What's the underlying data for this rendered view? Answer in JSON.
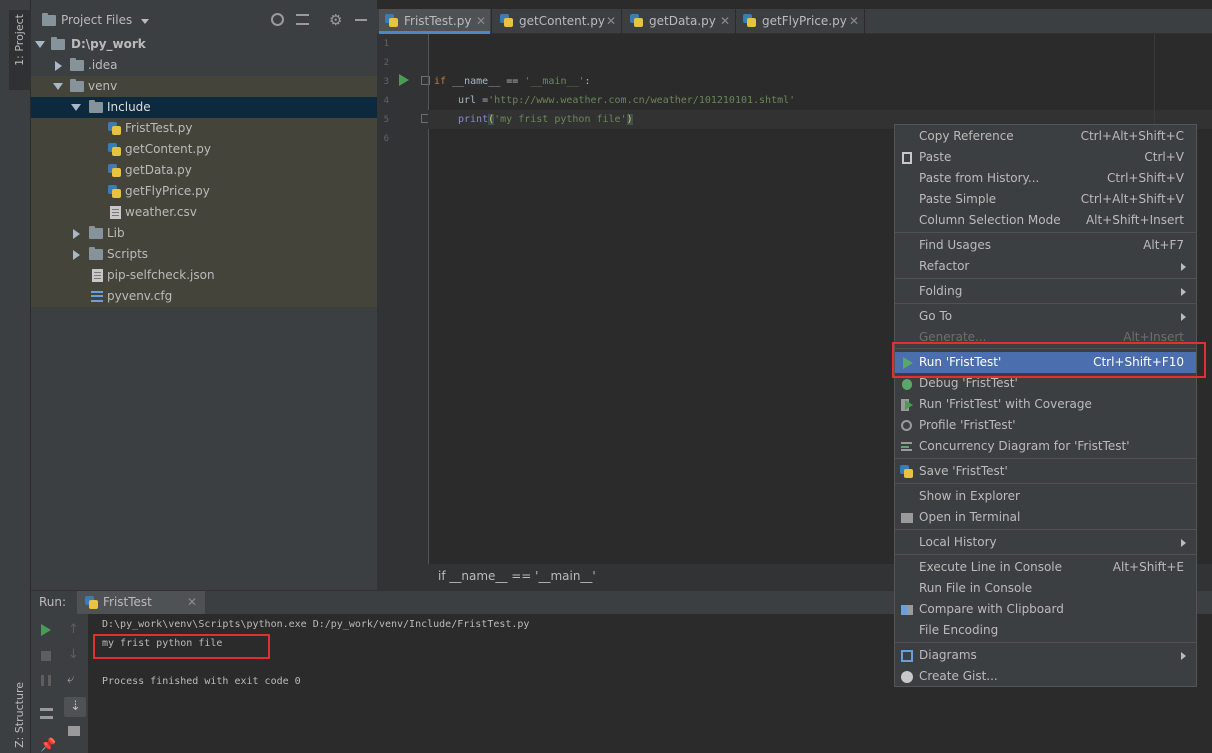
{
  "left_stripe": {
    "project_label": "1: Project",
    "structure_label": "Z: Structure"
  },
  "project": {
    "title": "Project Files",
    "tree": [
      {
        "label": "D:\\py_work"
      },
      {
        "label": ".idea"
      },
      {
        "label": "venv"
      },
      {
        "label": "Include"
      },
      {
        "label": "FristTest.py"
      },
      {
        "label": "getContent.py"
      },
      {
        "label": "getData.py"
      },
      {
        "label": "getFlyPrice.py"
      },
      {
        "label": "weather.csv"
      },
      {
        "label": "Lib"
      },
      {
        "label": "Scripts"
      },
      {
        "label": "pip-selfcheck.json"
      },
      {
        "label": "pyvenv.cfg"
      }
    ]
  },
  "tabs": [
    {
      "label": "FristTest.py",
      "active": true
    },
    {
      "label": "getContent.py"
    },
    {
      "label": "getData.py"
    },
    {
      "label": "getFlyPrice.py"
    }
  ],
  "editor": {
    "line_numbers": [
      "1",
      "2",
      "3",
      "4",
      "5",
      "6"
    ],
    "line3": {
      "kw_if": "if",
      "text1": " __name__ == ",
      "str1": "'__main__'",
      "text2": ":"
    },
    "line4": {
      "text1": "url =",
      "str1": "'http://www.weather.com.cn/weather/101210101.shtml'"
    },
    "line5": {
      "fn": "print",
      "paren_open": "(",
      "str1": "'my frist python file'",
      "paren_close": ")"
    },
    "breadcrumb": "if __name__ == '__main__'"
  },
  "run": {
    "label": "Run:",
    "tab": "FristTest",
    "console": [
      "D:\\py_work\\venv\\Scripts\\python.exe D:/py_work/venv/Include/FristTest.py",
      "my frist python file",
      "",
      "Process finished with exit code 0"
    ]
  },
  "context_menu": {
    "items": [
      {
        "label": "Copy Reference",
        "shortcut": "Ctrl+Alt+Shift+C"
      },
      {
        "label": "Paste",
        "shortcut": "Ctrl+V"
      },
      {
        "label": "Paste from History...",
        "shortcut": "Ctrl+Shift+V"
      },
      {
        "label": "Paste Simple",
        "shortcut": "Ctrl+Alt+Shift+V"
      },
      {
        "label": "Column Selection Mode",
        "shortcut": "Alt+Shift+Insert"
      },
      {
        "label": "Find Usages",
        "shortcut": "Alt+F7"
      },
      {
        "label": "Refactor",
        "shortcut": ""
      },
      {
        "label": "Folding",
        "shortcut": ""
      },
      {
        "label": "Go To",
        "shortcut": ""
      },
      {
        "label": "Generate...",
        "shortcut": "Alt+Insert"
      },
      {
        "label": "Run 'FristTest'",
        "shortcut": "Ctrl+Shift+F10"
      },
      {
        "label": "Debug 'FristTest'",
        "shortcut": ""
      },
      {
        "label": "Run 'FristTest' with Coverage",
        "shortcut": ""
      },
      {
        "label": "Profile 'FristTest'",
        "shortcut": ""
      },
      {
        "label": "Concurrency Diagram for 'FristTest'",
        "shortcut": ""
      },
      {
        "label": "Save 'FristTest'",
        "shortcut": ""
      },
      {
        "label": "Show in Explorer",
        "shortcut": ""
      },
      {
        "label": "Open in Terminal",
        "shortcut": ""
      },
      {
        "label": "Local History",
        "shortcut": ""
      },
      {
        "label": "Execute Line in Console",
        "shortcut": "Alt+Shift+E"
      },
      {
        "label": "Run File in Console",
        "shortcut": ""
      },
      {
        "label": "Compare with Clipboard",
        "shortcut": ""
      },
      {
        "label": "File Encoding",
        "shortcut": ""
      },
      {
        "label": "Diagrams",
        "shortcut": ""
      },
      {
        "label": "Create Gist...",
        "shortcut": ""
      }
    ]
  },
  "colors": {
    "accent": "#4b6eaf",
    "highlight_box": "#e0312f",
    "run_green": "#499c54"
  }
}
